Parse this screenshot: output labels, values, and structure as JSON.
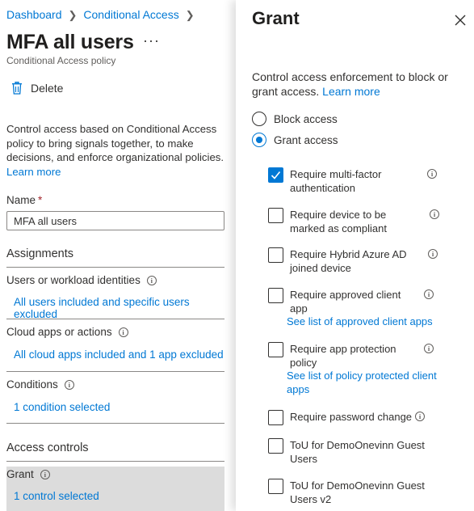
{
  "breadcrumb": {
    "items": [
      "Dashboard",
      "Conditional Access"
    ]
  },
  "page": {
    "title": "MFA all users",
    "more_label": "···",
    "subtitle": "Conditional Access policy",
    "delete_label": "Delete",
    "description": "Control access based on Conditional Access policy to bring signals together, to make decisions, and enforce organizational policies.",
    "learn_more": "Learn more"
  },
  "name_field": {
    "label": "Name",
    "required_mark": "*",
    "value": "MFA all users"
  },
  "assignments": {
    "heading": "Assignments",
    "users_label": "Users or workload identities",
    "users_value": "All users included and specific users excluded",
    "apps_label": "Cloud apps or actions",
    "apps_value": "All cloud apps included and 1 app excluded",
    "conditions_label": "Conditions",
    "conditions_value": "1 condition selected"
  },
  "access_controls": {
    "heading": "Access controls",
    "grant_label": "Grant",
    "grant_value": "1 control selected"
  },
  "grant_panel": {
    "title": "Grant",
    "description": "Control access enforcement to block or grant access.",
    "learn_more": "Learn more",
    "block_label": "Block access",
    "grant_label": "Grant access",
    "selected_option": "Grant access",
    "controls": [
      {
        "label": "Require multi-factor authentication",
        "checked": true
      },
      {
        "label": "Require device to be marked as compliant",
        "checked": false
      },
      {
        "label": "Require Hybrid Azure AD joined device",
        "checked": false
      },
      {
        "label": "Require approved client app",
        "checked": false,
        "link": "See list of approved client apps"
      },
      {
        "label": "Require app protection policy",
        "checked": false,
        "link": "See list of policy protected client apps"
      },
      {
        "label": "Require password change",
        "checked": false
      },
      {
        "label": "ToU for DemoOnevinn Guest Users",
        "checked": false
      },
      {
        "label": "ToU for DemoOnevinn Guest Users v2",
        "checked": false
      }
    ]
  },
  "colors": {
    "accent": "#0078d4",
    "text": "#323130",
    "selected_bg": "#dcdcdc",
    "required": "#a4262c"
  },
  "icons": [
    "trash-icon",
    "info-icon",
    "close-icon",
    "chevron-right-icon",
    "checkmark-icon"
  ]
}
